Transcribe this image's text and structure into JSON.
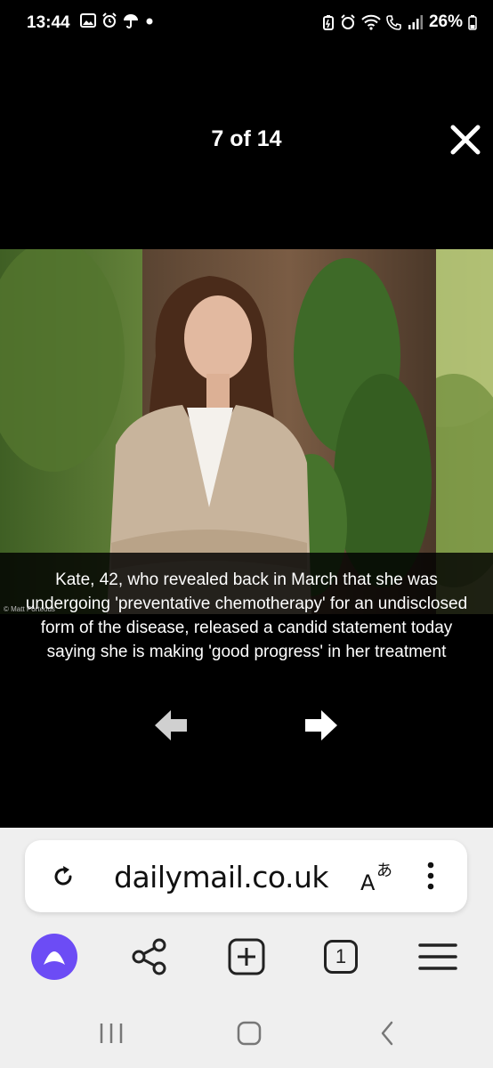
{
  "status_bar": {
    "time": "13:44",
    "battery": "26%",
    "left_icons": [
      "image-icon",
      "alarm-icon",
      "umbrella-icon",
      "dot-icon"
    ],
    "right_icons": [
      "battery-saver-icon",
      "alarm-icon",
      "wifi-icon",
      "wifi-call-icon",
      "signal-icon",
      "battery-icon"
    ]
  },
  "gallery": {
    "counter": "7 of 14",
    "caption": "Kate, 42, who revealed back in March that she was undergoing 'preventative chemotherapy' for an undisclosed form of the disease, released a candid statement today saying she is making 'good progress' in her treatment",
    "credit": "© Matt Porteous"
  },
  "browser": {
    "url": "dailymail.co.uk",
    "tabs_count": "1",
    "accent_color": "#6c4cf5"
  }
}
